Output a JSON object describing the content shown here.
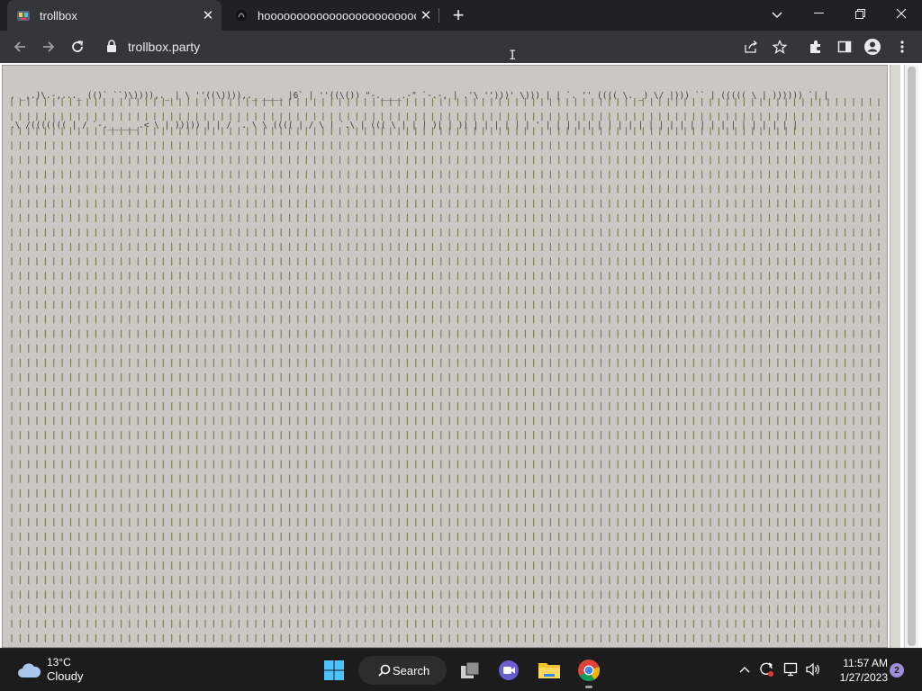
{
  "browser": {
    "tabs": [
      {
        "title": "trollbox",
        "active": true
      },
      {
        "title": "hoooooooooooooooooooooooooooo",
        "active": false
      }
    ],
    "address": {
      "url": "trollbox.party"
    }
  },
  "page": {
    "ascii_line_1": ", _,.)\\.-,..._ (()` ``)\\)))),._ | \\ ''((\\)))),._ ____ |6` | ''((\\()) \"-.____.-\" `-.-, | .'\\ '')))' \\))) | | `. '' (((( \\. _) \\/ |))) `` | ((((( \\ | )))))) `| |",
    "ascii_line_2": ".\\ /((((((( | / `-.______.< \\ | ))))) | | / `. \\ \\ (((( | / \\ | `.\\ | ((( \\ | | | )| | )) | | | | | | ' | | | | | | | | | | | | | | | | | | | | | | | | |",
    "bars_color": "#7a7a55",
    "background_color": "#c9c8c3"
  },
  "taskbar": {
    "weather": {
      "temp": "13°C",
      "condition": "Cloudy"
    },
    "search_label": "Search",
    "clock": {
      "time": "11:57 AM",
      "date": "1/27/2023"
    },
    "notification_count": "2"
  }
}
